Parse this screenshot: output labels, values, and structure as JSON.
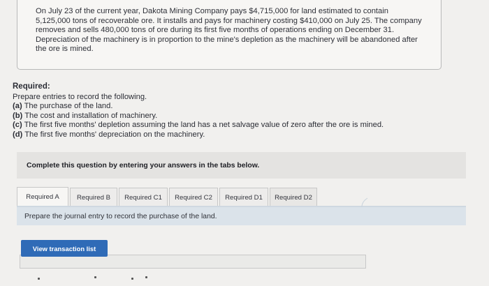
{
  "problem": {
    "text": "On July 23 of the current year, Dakota Mining Company pays $4,715,000 for land estimated to contain 5,125,000 tons of recoverable ore. It installs and pays for machinery costing $410,000 on July 25. The company removes and sells 480,000 tons of ore during its first five months of operations ending on December 31. Depreciation of the machinery is in proportion to the mine's depletion as the machinery will be abandoned after the ore is mined."
  },
  "required": {
    "heading": "Required:",
    "intro": "Prepare entries to record the following.",
    "items": [
      {
        "letter": "(a)",
        "text": "The purchase of the land."
      },
      {
        "letter": "(b)",
        "text": "The cost and installation of machinery."
      },
      {
        "letter": "(c)",
        "text": "The first five months' depletion assuming the land has a net salvage value of zero after the ore is mined."
      },
      {
        "letter": "(d)",
        "text": "The first five months' depreciation on the machinery."
      }
    ]
  },
  "instruction": "Complete this question by entering your answers in the tabs below.",
  "tabs": [
    {
      "label": "Required A",
      "active": true
    },
    {
      "label": "Required B",
      "active": false
    },
    {
      "label": "Required C1",
      "active": false
    },
    {
      "label": "Required C2",
      "active": false
    },
    {
      "label": "Required D1",
      "active": false
    },
    {
      "label": "Required D2",
      "active": false
    }
  ],
  "tab_prompt": "Prepare the journal entry to record the purchase of the land.",
  "view_button": "View transaction list",
  "colors": {
    "button": "#2f6bb7",
    "content_bar": "#dbe3ea",
    "instruction_bar": "#e4e3e1"
  }
}
